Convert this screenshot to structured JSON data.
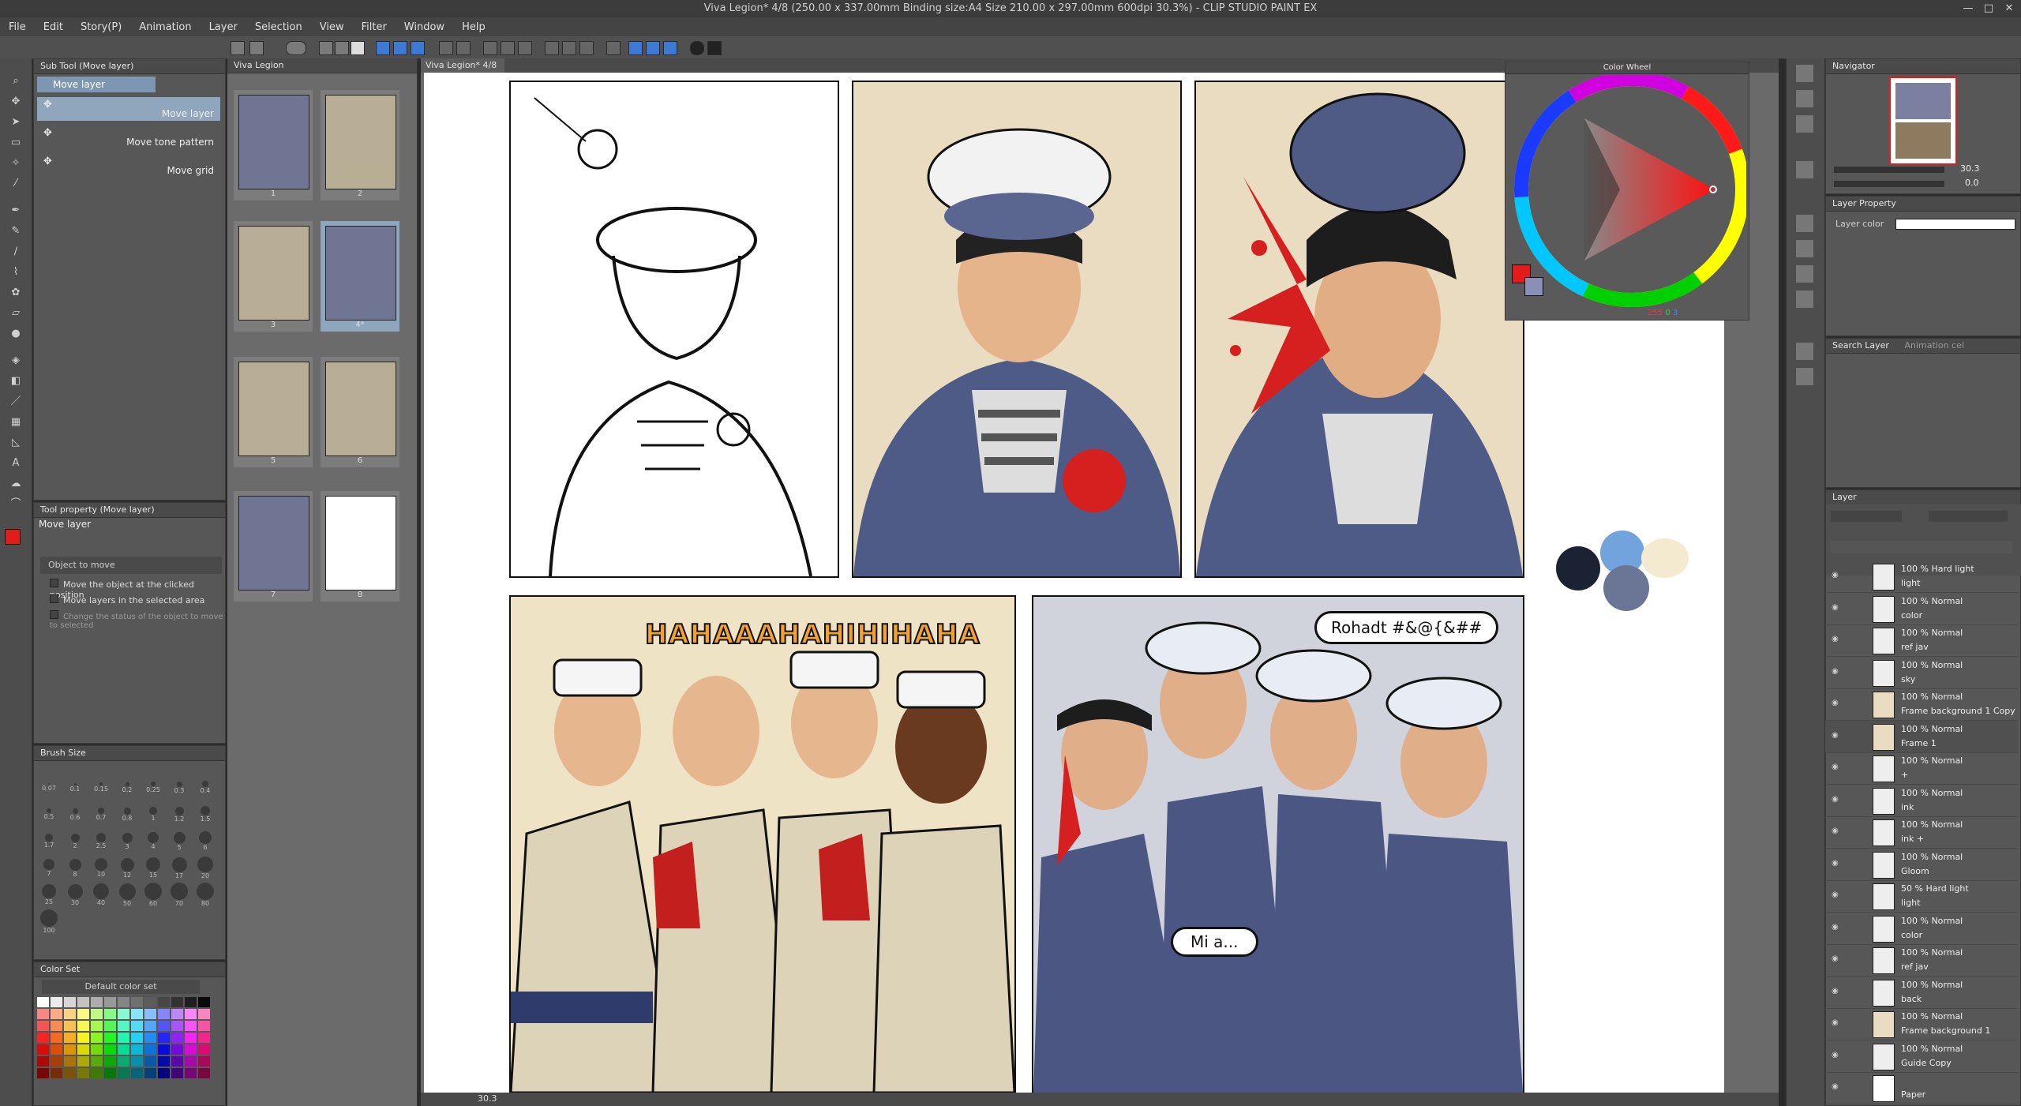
{
  "window": {
    "title": "Viva Legion* 4/8 (250.00 x 337.00mm Binding size:A4 Size 210.00 x 297.00mm 600dpi 30.3%) - CLIP STUDIO PAINT EX",
    "minimize": "—",
    "maximize": "□",
    "close": "✕"
  },
  "menu": [
    "File",
    "Edit",
    "Story(P)",
    "Animation",
    "Layer",
    "Selection",
    "View",
    "Filter",
    "Window",
    "Help"
  ],
  "subtool": {
    "title": "Sub Tool (Move layer)",
    "header_item": "Move layer",
    "items": [
      "Move layer",
      "Move tone pattern",
      "Move grid"
    ]
  },
  "tool_property": {
    "title": "Tool property (Move layer)",
    "tool_name": "Move layer",
    "object_label": "Object to move",
    "options": [
      "Move the object at the clicked position",
      "Move layers in the selected area",
      "Change the status of the object to move to selected"
    ]
  },
  "brush_size": {
    "title": "Brush Size",
    "sizes": [
      "0.07",
      "0.1",
      "0.15",
      "0.2",
      "0.25",
      "0.3",
      "0.4",
      "0.5",
      "0.6",
      "0.7",
      "0.8",
      "1",
      "1.2",
      "1.5",
      "1.7",
      "2",
      "2.5",
      "3",
      "4",
      "5",
      "6",
      "7",
      "8",
      "10",
      "12",
      "15",
      "17",
      "20",
      "25",
      "30",
      "40",
      "50",
      "60",
      "70",
      "80",
      "100"
    ]
  },
  "color_set": {
    "title": "Color Set",
    "set_name": "Default color set"
  },
  "pages_panel": {
    "title": "Viva Legion",
    "pages": [
      "1",
      "2",
      "3",
      "4*",
      "5",
      "6",
      "7",
      "8"
    ]
  },
  "canvas": {
    "tab": "Viva Legion* 4/8",
    "zoom": "30.3",
    "balloon_1": "Rohadt #&@{&##",
    "balloon_2": "Mi a...",
    "sfx": "HAHAAAHAHIHIHAHA"
  },
  "color_wheel": {
    "title": "Color Wheel",
    "main_color": "#e31b1b",
    "sub_color": "#8a8fb8",
    "rgb": [
      "255",
      "0",
      "3"
    ]
  },
  "navigator": {
    "title": "Navigator",
    "zoom": "30.3",
    "rotate": "0.0"
  },
  "layer_property": {
    "title": "Layer Property",
    "layer_color_label": "Layer color"
  },
  "search_layer": {
    "title": "Search Layer",
    "tab2": "Animation cel"
  },
  "layer_panel": {
    "title": "Layer",
    "layers": [
      {
        "mode": "100 % Hard light",
        "name": "light"
      },
      {
        "mode": "100 % Normal",
        "name": "color"
      },
      {
        "mode": "100 % Normal",
        "name": "ref jav"
      },
      {
        "mode": "100 % Normal",
        "name": "sky"
      },
      {
        "mode": "100 % Normal",
        "name": "Frame background 1 Copy"
      },
      {
        "mode": "100 % Normal",
        "name": "Frame 1"
      },
      {
        "mode": "100 % Normal",
        "name": "+"
      },
      {
        "mode": "100 % Normal",
        "name": "ink"
      },
      {
        "mode": "100 % Normal",
        "name": "ink +"
      },
      {
        "mode": "100 % Normal",
        "name": "Gloom"
      },
      {
        "mode": "50 % Hard light",
        "name": "light"
      },
      {
        "mode": "100 % Normal",
        "name": "color"
      },
      {
        "mode": "100 % Normal",
        "name": "ref jav"
      },
      {
        "mode": "100 % Normal",
        "name": "back"
      },
      {
        "mode": "100 % Normal",
        "name": "Frame background 1"
      },
      {
        "mode": "100 % Normal",
        "name": "Guide Copy"
      },
      {
        "mode": "",
        "name": "Paper"
      }
    ]
  },
  "colors": {
    "accent": "#e31b1b",
    "panel": "#575757",
    "sailor_blue": "#4e5b86",
    "beige": "#e9dcc0"
  }
}
